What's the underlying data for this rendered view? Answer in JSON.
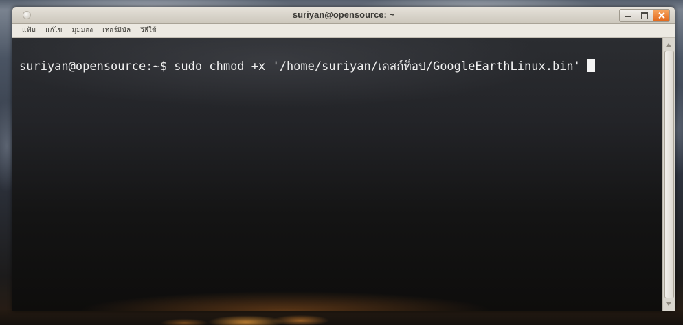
{
  "window": {
    "title": "suriyan@opensource: ~",
    "controls": {
      "window_menu": "window-menu-icon",
      "minimize": "minimize-icon",
      "maximize": "maximize-icon",
      "close": "close-icon"
    }
  },
  "menu": {
    "items": [
      {
        "label": "แฟ้ม"
      },
      {
        "label": "แก้ไข"
      },
      {
        "label": "มุมมอง"
      },
      {
        "label": "เทอร์มินัล"
      },
      {
        "label": "วิธีใช้"
      }
    ]
  },
  "terminal": {
    "lines": [
      {
        "prompt": "suriyan@opensource:~$",
        "command": "sudo chmod +x '/home/suriyan/เดสก์ท็อป/GoogleEarthLinux.bin'"
      }
    ]
  },
  "colors": {
    "close_button": "#e8732a",
    "terminal_text": "#f0f0f0",
    "titlebar": "#d8d3ca"
  }
}
